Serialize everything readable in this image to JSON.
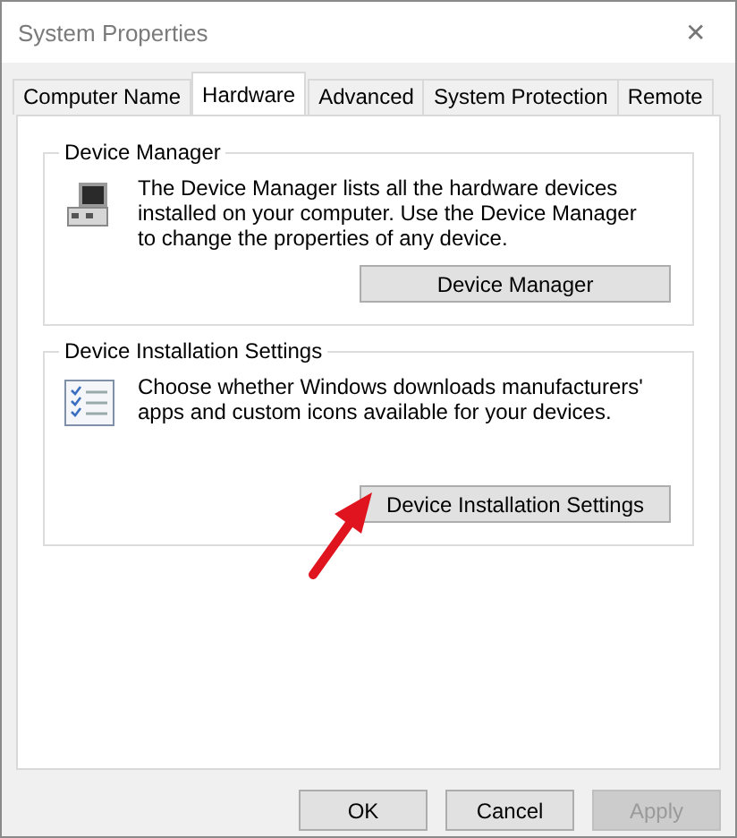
{
  "window": {
    "title": "System Properties",
    "close": "✕"
  },
  "tabs": [
    {
      "label": "Computer Name",
      "selected": false
    },
    {
      "label": "Hardware",
      "selected": true
    },
    {
      "label": "Advanced",
      "selected": false
    },
    {
      "label": "System Protection",
      "selected": false
    },
    {
      "label": "Remote",
      "selected": false
    }
  ],
  "groups": [
    {
      "title": "Device Manager",
      "kind": "device",
      "description": "The Device Manager lists all the hardware devices installed on your computer. Use the Device Manager to change the properties of any device.",
      "button": "Device Manager"
    },
    {
      "title": "Device Installation Settings",
      "kind": "settings",
      "description": "Choose whether Windows downloads manufacturers' apps and custom icons available for your devices.",
      "button": "Device Installation Settings"
    }
  ],
  "buttons": [
    {
      "label": "OK",
      "disabled": false
    },
    {
      "label": "Cancel",
      "disabled": false
    },
    {
      "label": "Apply",
      "disabled": true
    }
  ]
}
